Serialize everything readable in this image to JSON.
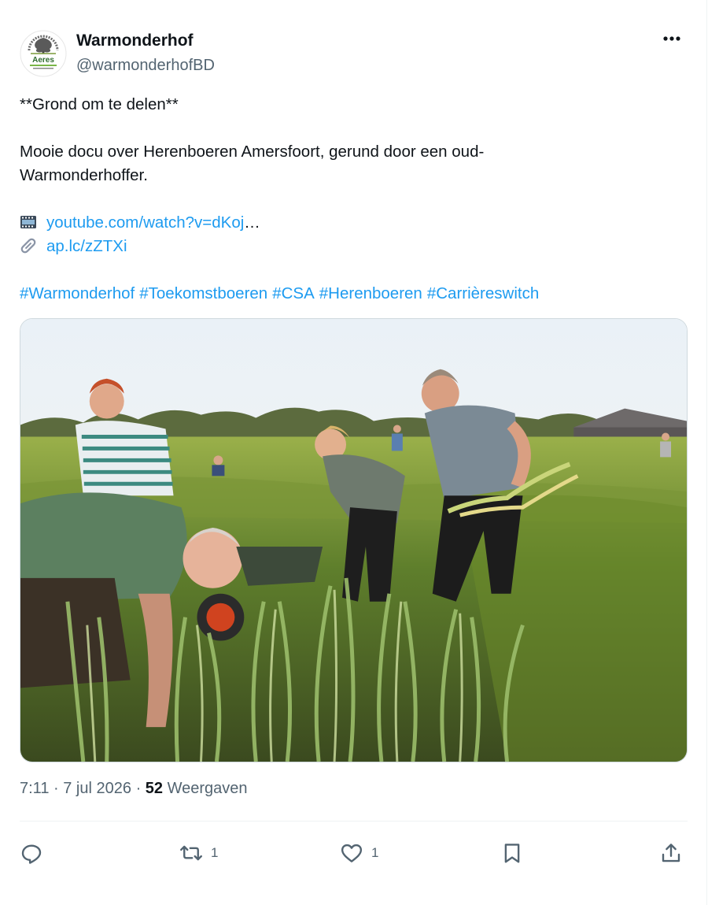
{
  "author": {
    "name": "Warmonderhof",
    "handle": "@warmonderhofBD",
    "avatar_icon": "warmonderhof-aeres-logo"
  },
  "post": {
    "title_line": "**Grond om te delen**",
    "description": [
      "Mooie docu over Herenboeren Amersfoort, gerund door een oud-",
      "Warmonderhoffer."
    ],
    "links": [
      {
        "icon": "film-frames-emoji",
        "text": "youtube.com/watch?v=dKoj",
        "ellipsis": "…"
      },
      {
        "icon": "paperclip-emoji",
        "text": "ap.lc/zZTXi",
        "ellipsis": ""
      }
    ],
    "hashtags": [
      "#Warmonderhof",
      "#Toekomstboeren",
      "#CSA",
      "#Herenboeren",
      "#Carrièreswitch"
    ]
  },
  "media": {
    "type": "photo",
    "subject": "people harvesting leeks in a field"
  },
  "meta": {
    "time": "7:11",
    "date": "7 jul 2026",
    "separator": "·",
    "views_count": "52",
    "views_label": "Weergaven"
  },
  "actions": {
    "reply_count": "",
    "retweet_count": "1",
    "like_count": "1"
  },
  "colors": {
    "link": "#1d9bf0",
    "text": "#0f1419",
    "secondary": "#536471",
    "divider": "#eff3f4"
  }
}
